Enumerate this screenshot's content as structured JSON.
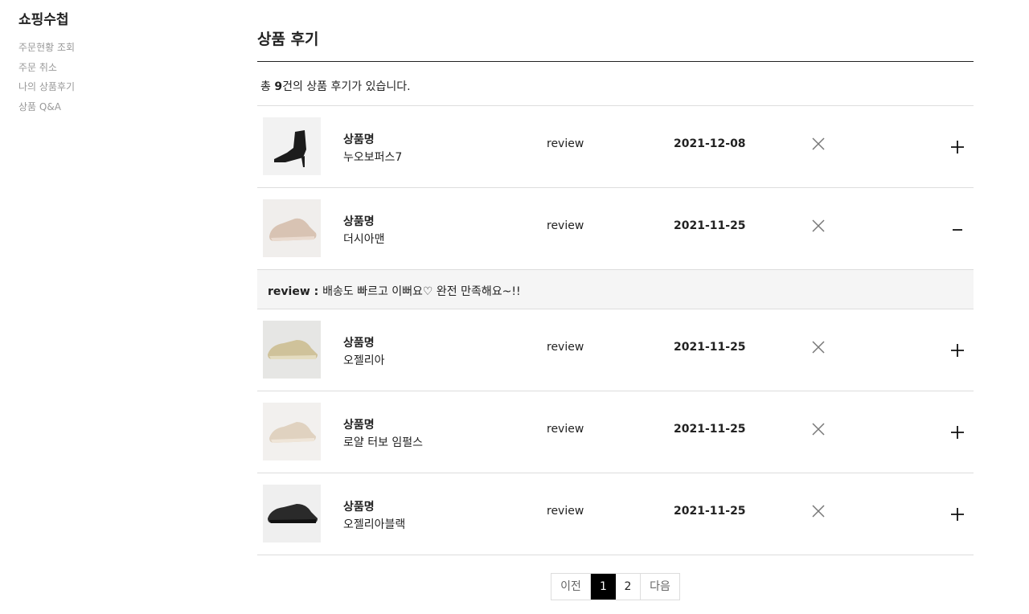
{
  "sidebar": {
    "title": "쇼핑수첩",
    "items": [
      "주문현황 조회",
      "주문 취소",
      "나의 상품후기",
      "상품 Q&A"
    ]
  },
  "page": {
    "title": "상품 후기",
    "summary_prefix": "총 ",
    "summary_count": "9",
    "summary_suffix": "건의 상품 후기가 있습니다."
  },
  "reviews": [
    {
      "name_label": "상품명",
      "name": "누오보퍼스7",
      "review_label": "review",
      "date": "2021-12-08",
      "toggle": "plus",
      "thumb": "boot"
    },
    {
      "name_label": "상품명",
      "name": "더시아맨",
      "review_label": "review",
      "date": "2021-11-25",
      "toggle": "minus",
      "thumb": "sneaker-beige",
      "detail_label": "review : ",
      "detail_text": "배송도 빠르고 이뻐요♡ 완전 만족해요~!!"
    },
    {
      "name_label": "상품명",
      "name": "오젤리아",
      "review_label": "review",
      "date": "2021-11-25",
      "toggle": "plus",
      "thumb": "sneaker-khaki"
    },
    {
      "name_label": "상품명",
      "name": "로얄 터보 임펄스",
      "review_label": "review",
      "date": "2021-11-25",
      "toggle": "plus",
      "thumb": "sneaker-cream"
    },
    {
      "name_label": "상품명",
      "name": "오젤리아블랙",
      "review_label": "review",
      "date": "2021-11-25",
      "toggle": "plus",
      "thumb": "sneaker-black"
    }
  ],
  "pagination": {
    "prev": "이전",
    "pages": [
      "1",
      "2"
    ],
    "current": "1",
    "next": "다음"
  },
  "colors": {
    "accent": "#000000",
    "border": "#dddddd",
    "detail_bg": "#f5f5f5",
    "sidebar_text": "#999999"
  }
}
